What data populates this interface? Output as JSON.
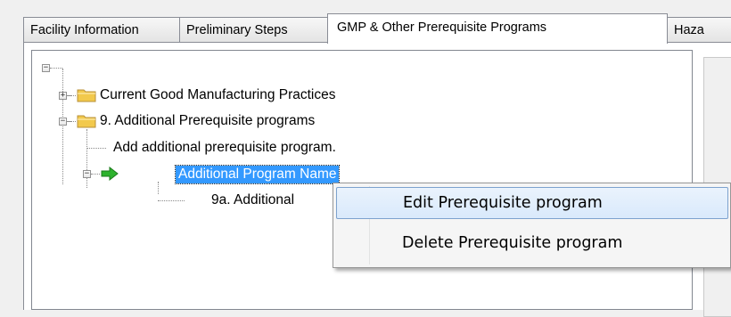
{
  "tabs": [
    {
      "label": "Facility Information",
      "active": false
    },
    {
      "label": "Preliminary Steps",
      "active": false
    },
    {
      "label": "GMP & Other Prerequisite Programs",
      "active": true
    },
    {
      "label": "Haza",
      "active": false
    }
  ],
  "tree": {
    "root_expander": "−",
    "nodes": {
      "current_gmp": {
        "label": "Current Good Manufacturing Practices",
        "expander": "+",
        "icon": "folder-icon"
      },
      "additional_prereq": {
        "label": "9. Additional Prerequisite programs",
        "expander": "−",
        "icon": "folder-icon"
      },
      "add_program": {
        "label": "Add additional prerequisite program."
      },
      "program_name": {
        "label": "Additional Program Name",
        "expander": "−",
        "icon": "green-arrow-icon",
        "selected": true
      },
      "child_9a": {
        "label": "9a. Additional"
      }
    }
  },
  "context_menu": {
    "items": [
      {
        "label": "Edit Prerequisite program",
        "highlighted": true
      },
      {
        "label": "Delete Prerequisite program",
        "highlighted": false
      }
    ]
  },
  "colors": {
    "selection": "#3399ff",
    "arrow": "#2db22d",
    "folder": "#f2c94c",
    "menu_highlight_border": "#7da2ce"
  }
}
